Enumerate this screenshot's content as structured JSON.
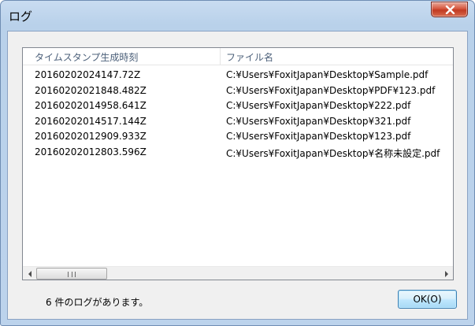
{
  "window": {
    "title": "ログ"
  },
  "list": {
    "columns": [
      "タイムスタンプ生成時刻",
      "ファイル名"
    ],
    "rows": [
      [
        "20160202024147.72Z",
        "C:¥Users¥FoxitJapan¥Desktop¥Sample.pdf"
      ],
      [
        "20160202021848.482Z",
        "C:¥Users¥FoxitJapan¥Desktop¥PDF¥123.pdf"
      ],
      [
        "20160202014958.641Z",
        "C:¥Users¥FoxitJapan¥Desktop¥222.pdf"
      ],
      [
        "20160202014517.144Z",
        "C:¥Users¥FoxitJapan¥Desktop¥321.pdf"
      ],
      [
        "20160202012909.933Z",
        "C:¥Users¥FoxitJapan¥Desktop¥123.pdf"
      ],
      [
        "20160202012803.596Z",
        "C:¥Users¥FoxitJapan¥Desktop¥名称未設定.pdf"
      ]
    ]
  },
  "footer": {
    "status": "6 件のログがあります。",
    "ok_label": "OK(O)"
  },
  "icons": {
    "close": "close-icon",
    "scroll_left": "arrow-left-icon",
    "scroll_right": "arrow-right-icon"
  },
  "colors": {
    "title_bar": "#b9d1ea",
    "close_button": "#c13a22",
    "header_text": "#4c607a",
    "ok_border": "#3c7fb1"
  }
}
